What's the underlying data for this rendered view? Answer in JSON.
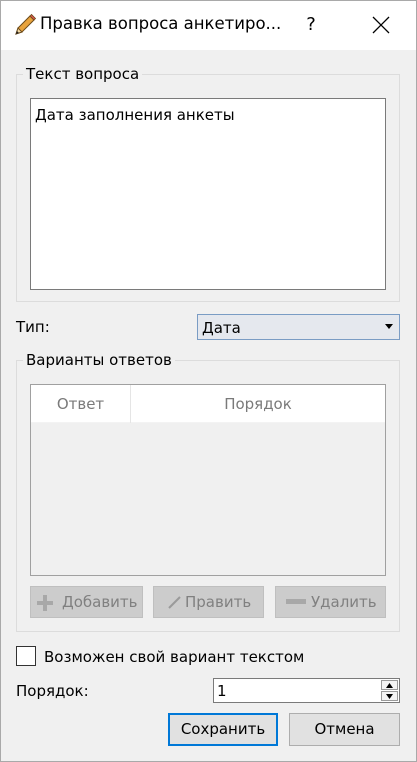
{
  "window": {
    "title": "Правка вопроса анкетиро...",
    "help_label": "?"
  },
  "question_group": {
    "title": "Текст вопроса",
    "text": "Дата заполнения анкеты"
  },
  "type_field": {
    "label": "Тип:",
    "selected": "Дата"
  },
  "answers_group": {
    "title": "Варианты ответов",
    "columns": [
      "Ответ",
      "Порядок"
    ],
    "rows": [],
    "buttons": {
      "add": "Добавить",
      "edit": "Править",
      "delete": "Удалить"
    }
  },
  "custom_option": {
    "label": "Возможен свой вариант текстом",
    "checked": false
  },
  "order_field": {
    "label": "Порядок:",
    "value": "1"
  },
  "actions": {
    "save": "Сохранить",
    "cancel": "Отмена"
  },
  "icons": {
    "window": "pencil-icon",
    "help": "help-icon",
    "close": "close-icon",
    "dropdown": "dropdown-arrow-icon",
    "add": "plus-icon",
    "edit": "pencil-icon",
    "delete": "minus-icon",
    "spin_up": "arrow-up-icon",
    "spin_down": "arrow-down-icon"
  },
  "colors": {
    "accent": "#0078d7",
    "background": "#f0f0f0"
  }
}
